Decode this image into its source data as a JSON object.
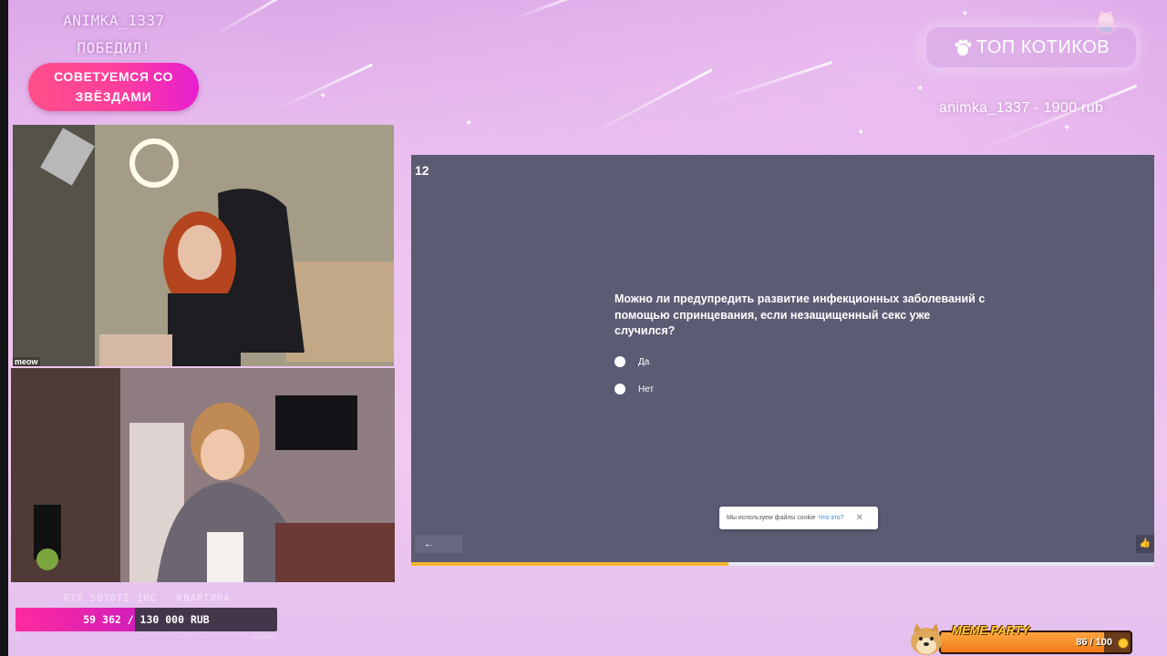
{
  "overlay": {
    "winner_line1": "ANIMKA_1337",
    "winner_line2": "ПОБЕДИЛ!",
    "stars_button_line1": "СОВЕТУЕМСЯ СО",
    "stars_button_line2": "ЗВЁЗДАМИ",
    "top_title": "ТОП КОТИКОВ",
    "top_donor": "animka_1337 - 1900 rub"
  },
  "cams": {
    "cam1_label": "meow"
  },
  "quiz": {
    "number": "12",
    "question": "Можно ли предупредить развитие инфекционных заболеваний с помощью спринцевания, если незащищенный секс уже случился?",
    "options": [
      "Да",
      "Нет"
    ],
    "cookie_text": "Мы используем файлы cookie",
    "cookie_link": "Что это?",
    "cookie_close": "✕",
    "back": "←",
    "like": "👍",
    "progress_fraction": 0.427
  },
  "goal": {
    "label": "RTX 5070TI 16G - КВАРТИРА",
    "text": "59 362 / 130 000 RUB",
    "fraction": 0.457,
    "min_label": "0",
    "max_label": "130 000"
  },
  "meme_party": {
    "title": "MEME PARTY",
    "count": "86 / 100",
    "fraction": 0.86
  },
  "colors": {
    "quiz_bg": "#5b5b73",
    "quiz_progress": "#f2b52e",
    "goal_fill": "#ff2aa0",
    "stars_button": "#ff3f9a"
  }
}
